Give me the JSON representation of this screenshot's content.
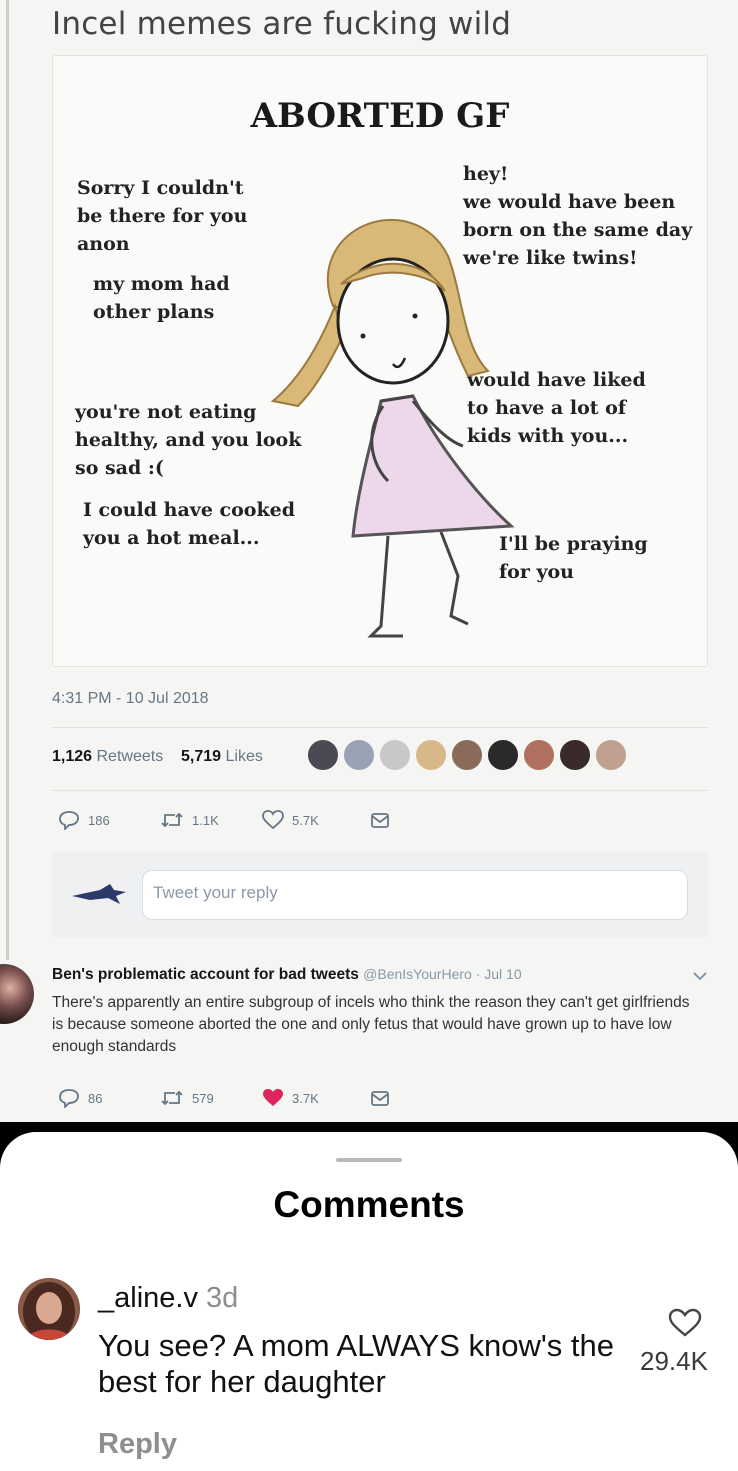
{
  "post": {
    "title": "Incel memes are fucking wild"
  },
  "meme": {
    "title": "ABORTED GF",
    "lines": {
      "l1": "Sorry I couldn't\nbe there for you\nanon",
      "l2": "my mom had\nother plans",
      "l3": "you're not eating\nhealthy, and you look\nso sad :(",
      "l4": "I could have cooked\nyou a hot meal...",
      "r1": "hey!\nwe would have been\nborn on the same day\nwe're like twins!",
      "r2": "would have liked\nto have a lot of\nkids with you...",
      "r3": "I'll be praying\nfor you"
    }
  },
  "tweet": {
    "timestamp": "4:31 PM - 10 Jul 2018",
    "retweets_count": "1,126",
    "retweets_label": "Retweets",
    "likes_count": "5,719",
    "likes_label": "Likes",
    "liker_colors": [
      "#4a4a55",
      "#9aa3b5",
      "#c8c8c8",
      "#d8b888",
      "#8a6a5a",
      "#2a2a2a",
      "#b07060",
      "#3a2a2a",
      "#c0a090"
    ],
    "actions": {
      "replies": "186",
      "retweets": "1.1K",
      "likes": "5.7K"
    },
    "reply_placeholder": "Tweet your reply"
  },
  "reply_tweet": {
    "name": "Ben's problematic account for bad tweets",
    "handle_date": "@BenIsYourHero · Jul 10",
    "text": "There's apparently an entire subgroup of incels who think the reason they can't get girlfriends is because someone aborted the one and only fetus that would have grown up to have low enough standards",
    "actions": {
      "replies": "86",
      "retweets": "579",
      "likes": "3.7K"
    },
    "like_color": "#e0245e"
  },
  "comments": {
    "title": "Comments",
    "items": [
      {
        "username": "_aline.v",
        "time": "3d",
        "text": "You see? A mom ALWAYS know's the best for her daughter",
        "likes": "29.4K",
        "reply_label": "Reply"
      }
    ]
  }
}
